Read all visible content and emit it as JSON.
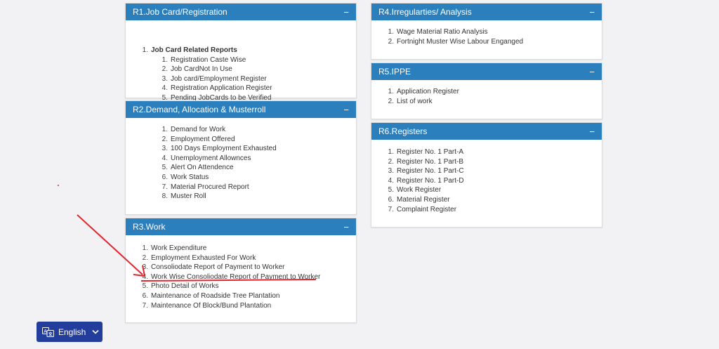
{
  "panels": {
    "r1": {
      "title": "R1.Job Card/Registration",
      "collapse": "−",
      "section": {
        "num": "1.",
        "label": "Job Card Related Reports"
      },
      "items": [
        {
          "num": "1.",
          "label": "Registration Caste Wise"
        },
        {
          "num": "2.",
          "label": "Job CardNot In Use"
        },
        {
          "num": "3.",
          "label": "Job card/Employment Register"
        },
        {
          "num": "4.",
          "label": "Registration Application Register"
        },
        {
          "num": "5.",
          "label": "Pending JobCards to be Verified"
        }
      ]
    },
    "r2": {
      "title": "R2.Demand, Allocation & Musterroll",
      "collapse": "−",
      "items": [
        {
          "num": "1.",
          "label": "Demand for Work"
        },
        {
          "num": "2.",
          "label": "Employment Offered"
        },
        {
          "num": "3.",
          "label": "100 Days Employment Exhausted"
        },
        {
          "num": "4.",
          "label": "Unemployment Allownces"
        },
        {
          "num": "5.",
          "label": "Alert On Attendence"
        },
        {
          "num": "6.",
          "label": "Work Status"
        },
        {
          "num": "7.",
          "label": "Material Procured Report"
        },
        {
          "num": "8.",
          "label": "Muster Roll"
        }
      ]
    },
    "r3": {
      "title": "R3.Work",
      "collapse": "−",
      "items": [
        {
          "num": "1.",
          "label": "Work Expenditure"
        },
        {
          "num": "2.",
          "label": "Employment Exhausted For Work"
        },
        {
          "num": "3.",
          "label": "Consoliodate Report of Payment to Worker"
        },
        {
          "num": "4.",
          "label": "Work Wise Consoliodate Report of Payment to Worker"
        },
        {
          "num": "5.",
          "label": "Photo Detail of Works"
        },
        {
          "num": "6.",
          "label": "Maintenance of Roadside Tree Plantation"
        },
        {
          "num": "7.",
          "label": "Maintenance Of Block/Bund Plantation"
        }
      ]
    },
    "r4": {
      "title": "R4.Irregularties/ Analysis",
      "collapse": "−",
      "items": [
        {
          "num": "1.",
          "label": "Wage Material Ratio Analysis"
        },
        {
          "num": "2.",
          "label": "Fortnight Muster Wise Labour Enganged"
        }
      ]
    },
    "r5": {
      "title": "R5.IPPE",
      "collapse": "−",
      "items": [
        {
          "num": "1.",
          "label": "Application Register"
        },
        {
          "num": "2.",
          "label": "List of work"
        }
      ]
    },
    "r6": {
      "title": "R6.Registers",
      "collapse": "−",
      "items": [
        {
          "num": "1.",
          "label": "Register No. 1 Part-A"
        },
        {
          "num": "2.",
          "label": "Register No. 1 Part-B"
        },
        {
          "num": "3.",
          "label": "Register No. 1 Part-C"
        },
        {
          "num": "4.",
          "label": "Register No. 1 Part-D"
        },
        {
          "num": "5.",
          "label": "Work Register"
        },
        {
          "num": "6.",
          "label": "Material Register"
        },
        {
          "num": "7.",
          "label": "Complaint Register"
        }
      ]
    }
  },
  "language_button": {
    "label": "English",
    "icon": "translate-icon",
    "chevron": "chevron-down-icon"
  },
  "colors": {
    "panel_header": "#2a7fbc",
    "language_button": "#233d9c",
    "annotation": "#e0262e",
    "background": "#f2f2f4"
  }
}
